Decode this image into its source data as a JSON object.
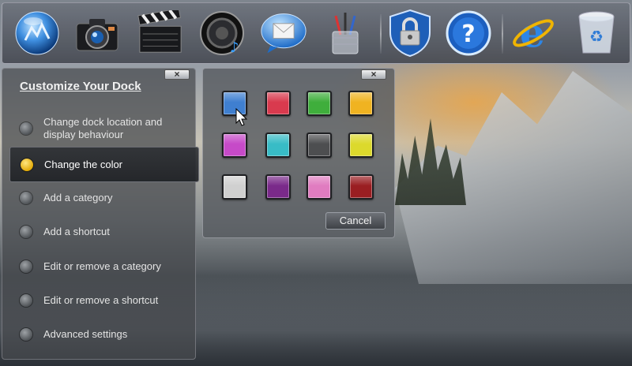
{
  "dock": {
    "icons": [
      {
        "name": "globe-icon"
      },
      {
        "name": "camera-icon"
      },
      {
        "name": "clapperboard-icon"
      },
      {
        "name": "speaker-icon"
      },
      {
        "name": "mail-icon"
      },
      {
        "name": "pencil-cup-icon"
      },
      {
        "name": "lock-shield-icon"
      },
      {
        "name": "help-icon"
      },
      {
        "name": "internet-explorer-icon"
      },
      {
        "name": "recycle-bin-icon"
      }
    ]
  },
  "customize_panel": {
    "close_label": "×",
    "title": "Customize Your Dock",
    "items": [
      {
        "label": "Change dock location and display behaviour",
        "active": false
      },
      {
        "label": "Change the color",
        "active": true
      },
      {
        "label": "Add a category",
        "active": false
      },
      {
        "label": "Add a shortcut",
        "active": false
      },
      {
        "label": "Edit or remove a category",
        "active": false
      },
      {
        "label": "Edit or remove a shortcut",
        "active": false
      },
      {
        "label": "Advanced settings",
        "active": false
      }
    ]
  },
  "color_picker": {
    "close_label": "×",
    "swatches": [
      {
        "name": "blue",
        "color": "#3f7fd0"
      },
      {
        "name": "red",
        "color": "#d93a4e"
      },
      {
        "name": "green",
        "color": "#3fae3c"
      },
      {
        "name": "orange",
        "color": "#f0b321"
      },
      {
        "name": "magenta",
        "color": "#c64ac8"
      },
      {
        "name": "teal",
        "color": "#38bcc6"
      },
      {
        "name": "dark-gray",
        "color": "#4d4e50"
      },
      {
        "name": "yellow",
        "color": "#dcd92c"
      },
      {
        "name": "light-gray",
        "color": "#d0d0d0"
      },
      {
        "name": "purple",
        "color": "#7a2a8a"
      },
      {
        "name": "pink",
        "color": "#e07cc0"
      },
      {
        "name": "dark-red",
        "color": "#9a1e22"
      }
    ],
    "cancel_label": "Cancel"
  }
}
